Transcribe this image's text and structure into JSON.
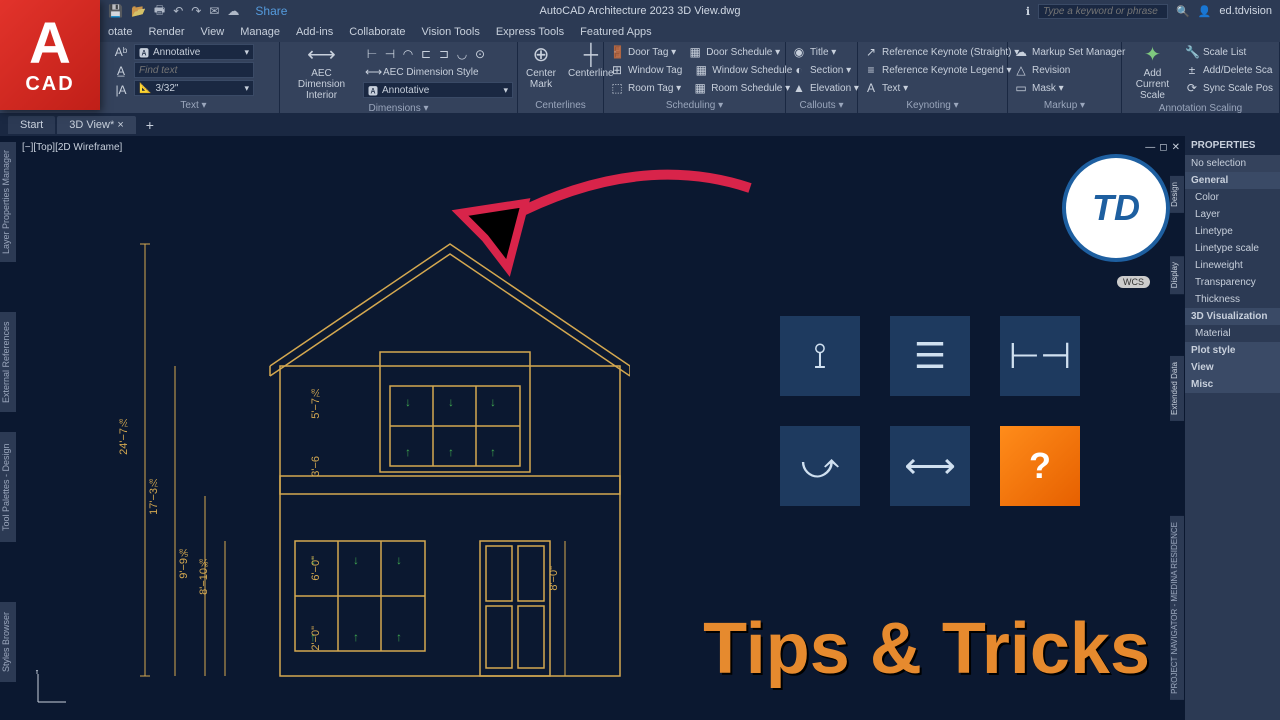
{
  "app": {
    "logo_letter": "A",
    "logo_text": "CAD",
    "title": "AutoCAD Architecture 2023   3D View.dwg",
    "search_placeholder": "Type a keyword or phrase",
    "user": "ed.tdvision",
    "share": "Share"
  },
  "menu": [
    "otate",
    "Render",
    "View",
    "Manage",
    "Add-ins",
    "Collaborate",
    "Vision Tools",
    "Express Tools",
    "Featured Apps"
  ],
  "ribbon": {
    "text": {
      "style": "Annotative",
      "find": "Find text",
      "scale": "3/32\"",
      "title": "Text ▾"
    },
    "dims": {
      "btn": "AEC Dimension\nInterior",
      "style": "AEC Dimension Style",
      "anno": "Annotative",
      "title": "Dimensions ▾"
    },
    "center": {
      "b1": "Center\nMark",
      "b2": "Centerline",
      "title": "Centerlines"
    },
    "sched": {
      "r1": [
        "Door Tag ▾",
        "Door Schedule ▾"
      ],
      "r2": [
        "Window Tag",
        "Window Schedule"
      ],
      "r3": [
        "Room Tag ▾",
        "Room Schedule ▾"
      ],
      "title": "Scheduling ▾"
    },
    "call": {
      "r": [
        "Title ▾",
        "Section ▾",
        "Elevation ▾"
      ],
      "title": "Callouts ▾"
    },
    "key": {
      "r": [
        "Reference Keynote (Straight) ▾",
        "Reference Keynote Legend ▾",
        "Text ▾"
      ],
      "title": "Keynoting ▾"
    },
    "markup": {
      "r": [
        "Markup Set Manager",
        "Revision",
        "Mask ▾"
      ],
      "title": "Markup ▾"
    },
    "anno": {
      "btn": "Add\nCurrent Scale",
      "r": [
        "Scale List",
        "Add/Delete Sca",
        "Sync Scale Pos"
      ],
      "title": "Annotation Scaling"
    }
  },
  "tabs": {
    "start": "Start",
    "view": "3D View*"
  },
  "viewport": {
    "label": "[−][Top][2D Wireframe]"
  },
  "sidetabs": [
    "Layer Properties Manager",
    "External References",
    "Tool Palettes - Design",
    "Styles Browser"
  ],
  "props": {
    "header": "PROPERTIES",
    "sel": "No selection",
    "general": {
      "title": "General",
      "rows": [
        "Color",
        "Layer",
        "Linetype",
        "Linetype scale",
        "Lineweight",
        "Transparency",
        "Thickness"
      ]
    },
    "vis": {
      "title": "3D Visualization",
      "rows": [
        "Material"
      ]
    },
    "extra": [
      "Plot style",
      "View",
      "Misc"
    ],
    "vtabs": [
      "Design",
      "Display",
      "Extended Data"
    ]
  },
  "right_vtab": "PROJECT NAVIGATOR - MEDINA RESIDENCE",
  "dims": {
    "h": "24'−7⅞",
    "h17": "17'−3⅞",
    "h9": "9'−9⅝",
    "h8": "8'−10⅜",
    "u57": "5'−7⅞",
    "u36": "3'−6",
    "l6": "6'−0\"",
    "l2": "2'−0\"",
    "r8": "8'−0\""
  },
  "overlay": "Tips & Tricks",
  "wcs": "WCS",
  "badge": "TD",
  "tile6": "?"
}
